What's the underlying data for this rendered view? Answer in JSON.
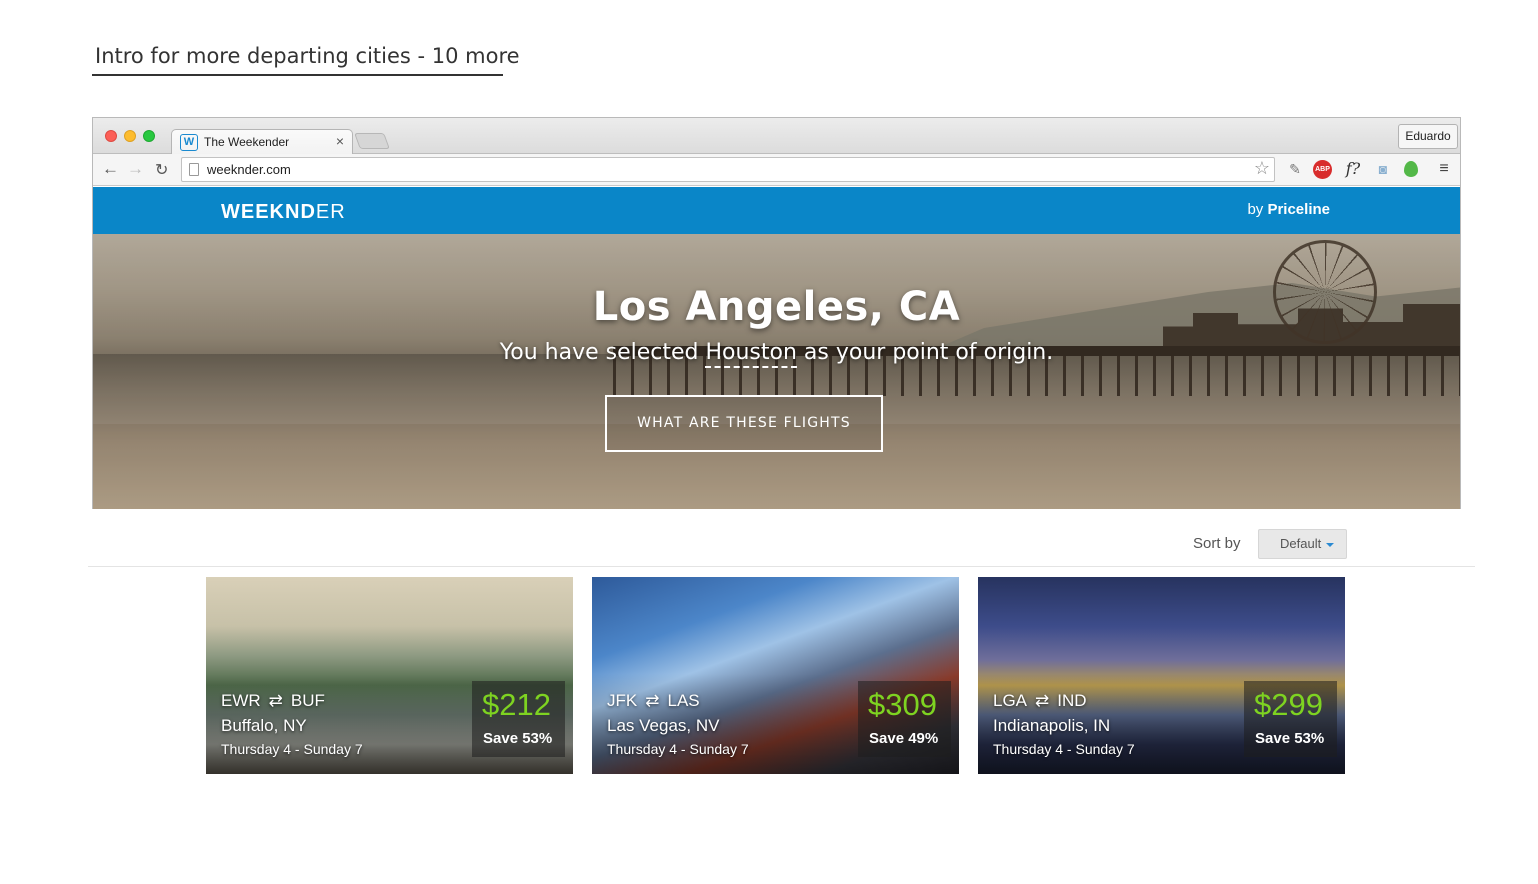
{
  "annotation": {
    "caption": "Intro for more departing cities - 10 more"
  },
  "browser": {
    "tab_favicon": "W",
    "tab_title": "The Weekender",
    "tab_close": "×",
    "profile_name": "Eduardo",
    "url": "weeknder.com",
    "nav": {
      "back": "←",
      "forward": "→",
      "reload": "↻"
    },
    "star": "☆",
    "extensions": {
      "tools": "✎",
      "abp": "ABP",
      "font": "f?",
      "camera": "◙",
      "menu": "≡"
    }
  },
  "site": {
    "logo_bold": "WEEKND",
    "logo_light": "ER",
    "byline_prefix": "by ",
    "byline_brand": "Priceline",
    "accent_color": "#0a86c8"
  },
  "hero": {
    "city": "Los Angeles,  CA",
    "sub_before": "You have selected ",
    "origin": "Houston",
    "sub_after": " as your point of origin.",
    "button": "WHAT ARE THESE FLIGHTS"
  },
  "sort": {
    "label": "Sort by",
    "selected": "Default"
  },
  "deals": [
    {
      "from": "EWR",
      "to": "BUF",
      "route_icon": "⇄",
      "city": "Buffalo, NY",
      "dates": "Thursday 4 - Sunday 7",
      "price": "$212",
      "save": "Save 53%"
    },
    {
      "from": "JFK",
      "to": "LAS",
      "route_icon": "⇄",
      "city": "Las Vegas, NV",
      "dates": "Thursday 4 - Sunday 7",
      "price": "$309",
      "save": "Save 49%"
    },
    {
      "from": "LGA",
      "to": "IND",
      "route_icon": "⇄",
      "city": "Indianapolis, IN",
      "dates": "Thursday 4 - Sunday 7",
      "price": "$299",
      "save": "Save 53%"
    }
  ],
  "colors": {
    "price_green": "#7ed321",
    "header_blue": "#0a86c8"
  }
}
